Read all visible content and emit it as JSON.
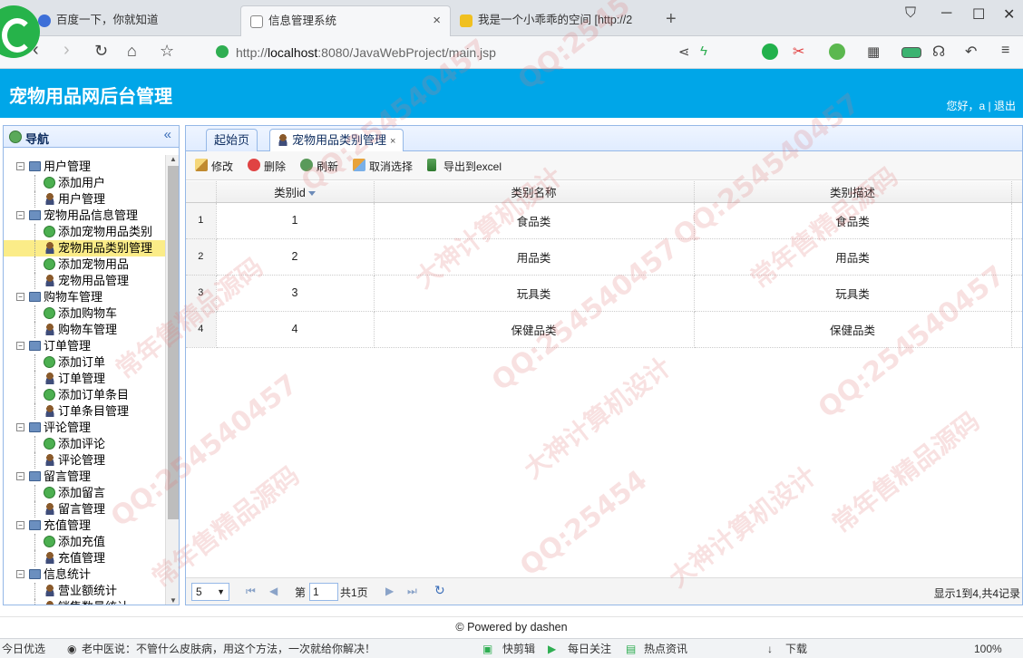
{
  "browser": {
    "tabs": [
      {
        "title": "百度一下，你就知道"
      },
      {
        "title": "信息管理系统"
      },
      {
        "title": "我是一个小乖乖的空间 [http://2"
      }
    ],
    "url_prefix": "http://",
    "url_host": "localhost",
    "url_rest": ":8080/JavaWebProject/main.jsp"
  },
  "header": {
    "title": "宠物用品网后台管理",
    "greeting": "您好，a",
    "logout": "退出"
  },
  "nav": {
    "title": "导航",
    "groups": [
      {
        "label": "用户管理",
        "items": [
          "添加用户",
          "用户管理"
        ]
      },
      {
        "label": "宠物用品信息管理",
        "items": [
          "添加宠物用品类别",
          "宠物用品类别管理",
          "添加宠物用品",
          "宠物用品管理"
        ]
      },
      {
        "label": "购物车管理",
        "items": [
          "添加购物车",
          "购物车管理"
        ]
      },
      {
        "label": "订单管理",
        "items": [
          "添加订单",
          "订单管理",
          "添加订单条目",
          "订单条目管理"
        ]
      },
      {
        "label": "评论管理",
        "items": [
          "添加评论",
          "评论管理"
        ]
      },
      {
        "label": "留言管理",
        "items": [
          "添加留言",
          "留言管理"
        ]
      },
      {
        "label": "充值管理",
        "items": [
          "添加充值",
          "充值管理"
        ]
      },
      {
        "label": "信息统计",
        "items": [
          "营业额统计",
          "销售数量统计"
        ]
      }
    ],
    "selected": "宠物用品类别管理"
  },
  "main": {
    "tabs": [
      {
        "label": "起始页"
      },
      {
        "label": "宠物用品类别管理"
      }
    ],
    "toolbar": {
      "edit": "修改",
      "delete": "删除",
      "refresh": "刷新",
      "unselect": "取消选择",
      "export": "导出到excel"
    },
    "columns": [
      "类别id",
      "类别名称",
      "类别描述"
    ],
    "rows": [
      {
        "n": "1",
        "id": "1",
        "name": "食品类",
        "desc": "食品类"
      },
      {
        "n": "2",
        "id": "2",
        "name": "用品类",
        "desc": "用品类"
      },
      {
        "n": "3",
        "id": "3",
        "name": "玩具类",
        "desc": "玩具类"
      },
      {
        "n": "4",
        "id": "4",
        "name": "保健品类",
        "desc": "保健品类"
      }
    ],
    "pager": {
      "page_size": "5",
      "page_prefix": "第",
      "page_value": "1",
      "page_suffix": "共1页",
      "info": "显示1到4,共4记录"
    }
  },
  "footer": {
    "text": "© Powered by dashen"
  },
  "statusbar": {
    "left": "今日优选",
    "news": "老中医说：不管什么皮肤病，用这个方法，一次就给你解决！",
    "clip": "快剪辑",
    "daily": "每日关注",
    "hot": "热点资讯",
    "download": "下载",
    "zoom": "100%"
  },
  "watermark": {
    "qq": "QQ:2545",
    "qq2": "QQ:25454",
    "qq3": "QQ:254540457",
    "w1": "大神计算机设计",
    "w2": "常年售精品源码"
  }
}
